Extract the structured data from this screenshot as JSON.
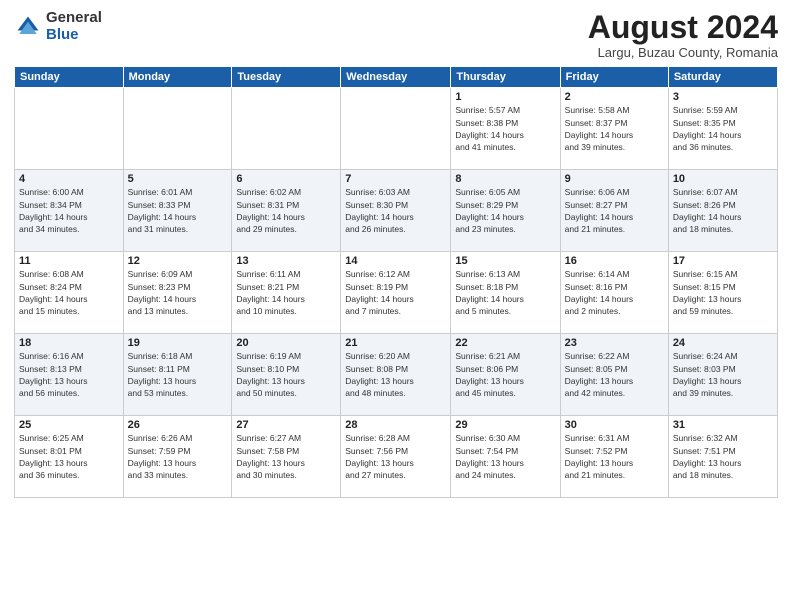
{
  "header": {
    "logo_general": "General",
    "logo_blue": "Blue",
    "month_title": "August 2024",
    "location": "Largu, Buzau County, Romania"
  },
  "weekdays": [
    "Sunday",
    "Monday",
    "Tuesday",
    "Wednesday",
    "Thursday",
    "Friday",
    "Saturday"
  ],
  "weeks": [
    [
      {
        "day": "",
        "detail": ""
      },
      {
        "day": "",
        "detail": ""
      },
      {
        "day": "",
        "detail": ""
      },
      {
        "day": "",
        "detail": ""
      },
      {
        "day": "1",
        "detail": "Sunrise: 5:57 AM\nSunset: 8:38 PM\nDaylight: 14 hours\nand 41 minutes."
      },
      {
        "day": "2",
        "detail": "Sunrise: 5:58 AM\nSunset: 8:37 PM\nDaylight: 14 hours\nand 39 minutes."
      },
      {
        "day": "3",
        "detail": "Sunrise: 5:59 AM\nSunset: 8:35 PM\nDaylight: 14 hours\nand 36 minutes."
      }
    ],
    [
      {
        "day": "4",
        "detail": "Sunrise: 6:00 AM\nSunset: 8:34 PM\nDaylight: 14 hours\nand 34 minutes."
      },
      {
        "day": "5",
        "detail": "Sunrise: 6:01 AM\nSunset: 8:33 PM\nDaylight: 14 hours\nand 31 minutes."
      },
      {
        "day": "6",
        "detail": "Sunrise: 6:02 AM\nSunset: 8:31 PM\nDaylight: 14 hours\nand 29 minutes."
      },
      {
        "day": "7",
        "detail": "Sunrise: 6:03 AM\nSunset: 8:30 PM\nDaylight: 14 hours\nand 26 minutes."
      },
      {
        "day": "8",
        "detail": "Sunrise: 6:05 AM\nSunset: 8:29 PM\nDaylight: 14 hours\nand 23 minutes."
      },
      {
        "day": "9",
        "detail": "Sunrise: 6:06 AM\nSunset: 8:27 PM\nDaylight: 14 hours\nand 21 minutes."
      },
      {
        "day": "10",
        "detail": "Sunrise: 6:07 AM\nSunset: 8:26 PM\nDaylight: 14 hours\nand 18 minutes."
      }
    ],
    [
      {
        "day": "11",
        "detail": "Sunrise: 6:08 AM\nSunset: 8:24 PM\nDaylight: 14 hours\nand 15 minutes."
      },
      {
        "day": "12",
        "detail": "Sunrise: 6:09 AM\nSunset: 8:23 PM\nDaylight: 14 hours\nand 13 minutes."
      },
      {
        "day": "13",
        "detail": "Sunrise: 6:11 AM\nSunset: 8:21 PM\nDaylight: 14 hours\nand 10 minutes."
      },
      {
        "day": "14",
        "detail": "Sunrise: 6:12 AM\nSunset: 8:19 PM\nDaylight: 14 hours\nand 7 minutes."
      },
      {
        "day": "15",
        "detail": "Sunrise: 6:13 AM\nSunset: 8:18 PM\nDaylight: 14 hours\nand 5 minutes."
      },
      {
        "day": "16",
        "detail": "Sunrise: 6:14 AM\nSunset: 8:16 PM\nDaylight: 14 hours\nand 2 minutes."
      },
      {
        "day": "17",
        "detail": "Sunrise: 6:15 AM\nSunset: 8:15 PM\nDaylight: 13 hours\nand 59 minutes."
      }
    ],
    [
      {
        "day": "18",
        "detail": "Sunrise: 6:16 AM\nSunset: 8:13 PM\nDaylight: 13 hours\nand 56 minutes."
      },
      {
        "day": "19",
        "detail": "Sunrise: 6:18 AM\nSunset: 8:11 PM\nDaylight: 13 hours\nand 53 minutes."
      },
      {
        "day": "20",
        "detail": "Sunrise: 6:19 AM\nSunset: 8:10 PM\nDaylight: 13 hours\nand 50 minutes."
      },
      {
        "day": "21",
        "detail": "Sunrise: 6:20 AM\nSunset: 8:08 PM\nDaylight: 13 hours\nand 48 minutes."
      },
      {
        "day": "22",
        "detail": "Sunrise: 6:21 AM\nSunset: 8:06 PM\nDaylight: 13 hours\nand 45 minutes."
      },
      {
        "day": "23",
        "detail": "Sunrise: 6:22 AM\nSunset: 8:05 PM\nDaylight: 13 hours\nand 42 minutes."
      },
      {
        "day": "24",
        "detail": "Sunrise: 6:24 AM\nSunset: 8:03 PM\nDaylight: 13 hours\nand 39 minutes."
      }
    ],
    [
      {
        "day": "25",
        "detail": "Sunrise: 6:25 AM\nSunset: 8:01 PM\nDaylight: 13 hours\nand 36 minutes."
      },
      {
        "day": "26",
        "detail": "Sunrise: 6:26 AM\nSunset: 7:59 PM\nDaylight: 13 hours\nand 33 minutes."
      },
      {
        "day": "27",
        "detail": "Sunrise: 6:27 AM\nSunset: 7:58 PM\nDaylight: 13 hours\nand 30 minutes."
      },
      {
        "day": "28",
        "detail": "Sunrise: 6:28 AM\nSunset: 7:56 PM\nDaylight: 13 hours\nand 27 minutes."
      },
      {
        "day": "29",
        "detail": "Sunrise: 6:30 AM\nSunset: 7:54 PM\nDaylight: 13 hours\nand 24 minutes."
      },
      {
        "day": "30",
        "detail": "Sunrise: 6:31 AM\nSunset: 7:52 PM\nDaylight: 13 hours\nand 21 minutes."
      },
      {
        "day": "31",
        "detail": "Sunrise: 6:32 AM\nSunset: 7:51 PM\nDaylight: 13 hours\nand 18 minutes."
      }
    ]
  ]
}
